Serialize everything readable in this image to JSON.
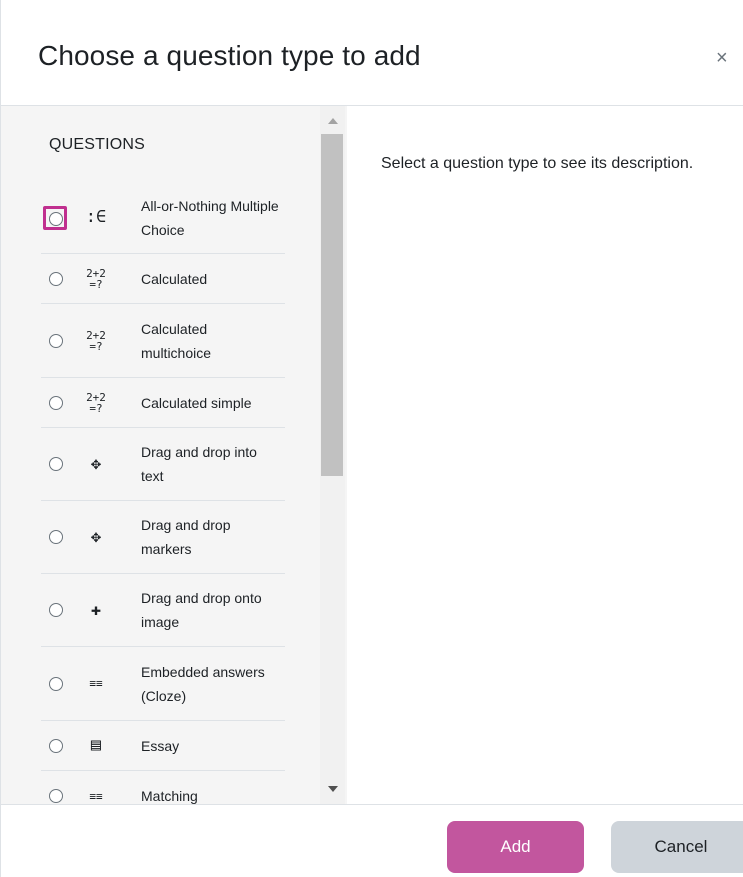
{
  "dialog": {
    "title": "Choose a question type to add",
    "close_label": "×"
  },
  "left": {
    "heading": "QUESTIONS",
    "items": [
      {
        "icon": ":∈",
        "label": "All-or-Nothing Multiple Choice"
      },
      {
        "icon": "2+2\n=?",
        "label": "Calculated"
      },
      {
        "icon": "2+2\n=?",
        "label": "Calculated multichoice"
      },
      {
        "icon": "2+2\n=?",
        "label": "Calculated simple"
      },
      {
        "icon": "✥",
        "label": "Drag and drop into text"
      },
      {
        "icon": "✥",
        "label": "Drag and drop markers"
      },
      {
        "icon": "✚",
        "label": "Drag and drop onto image"
      },
      {
        "icon": "≡≡",
        "label": "Embedded answers (Cloze)"
      },
      {
        "icon": "▤",
        "label": "Essay"
      },
      {
        "icon": "≡≡",
        "label": "Matching"
      }
    ]
  },
  "right": {
    "description": "Select a question type to see its description."
  },
  "footer": {
    "add_label": "Add",
    "cancel_label": "Cancel"
  },
  "colors": {
    "primary": "#c2569e",
    "focus": "#c02f8f",
    "secondary": "#ced4da"
  }
}
